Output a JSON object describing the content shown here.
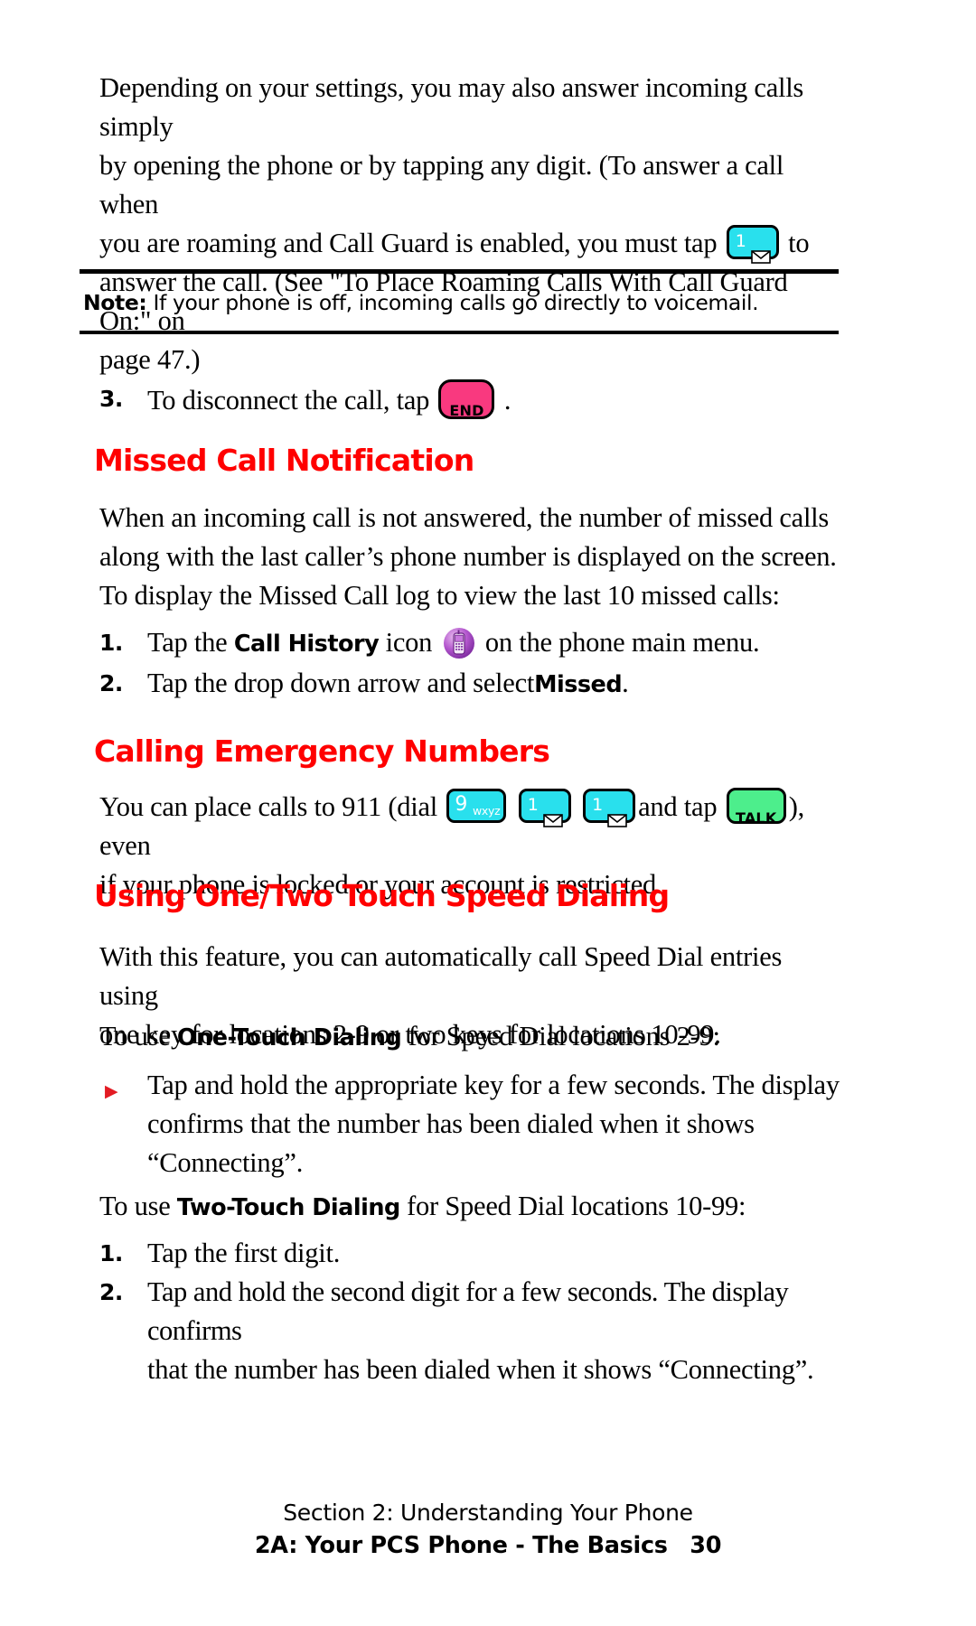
{
  "page": {
    "number": "30",
    "background": "#ffffff"
  },
  "colors": {
    "heading_red": "#FF0000",
    "key_cyan": "#29E0ED",
    "key_end_pink": "#F9397F",
    "key_talk_green": "#4DEE8C",
    "icon_purple": "#9B3FBF",
    "bullet_red": "#E31B23",
    "text_black": "#000000"
  },
  "intro": {
    "paragraph_line1": "Depending on your settings, you may also answer incoming calls simply",
    "paragraph_line2": "by opening the phone or by tapping any digit. (To answer a call when",
    "paragraph_line3_before_key": "you are roaming and Call Guard is enabled, you must tap",
    "paragraph_line3_after_key": "to",
    "paragraph_line4": "answer the call. (See \"To Place Roaming Calls With Call Guard On:\" on",
    "paragraph_line5": "page 47.)"
  },
  "note": {
    "label": "Note:",
    "text": "If your phone is off, incoming calls go directly to voicemail."
  },
  "step3": {
    "marker": "3.",
    "text_before_key": "To disconnect the call, tap",
    "text_after_key": "."
  },
  "missed_call": {
    "heading": "Missed Call Notification",
    "para1_line1": "When an incoming call is not answered, the number of missed calls",
    "para1_line2": "along with the last caller’s phone number is displayed on the screen.",
    "para2": "To display the Missed Call log to view the last 10 missed calls:",
    "steps": [
      {
        "marker": "1.",
        "before_bold": "Tap the",
        "bold": "Call History",
        "after_bold": "icon",
        "after_icon": "on the phone main menu."
      },
      {
        "marker": "2.",
        "before_bold": "Tap the drop down arrow and select",
        "bold": "Missed",
        "after_bold": "."
      }
    ]
  },
  "emergency": {
    "heading": "Calling Emergency Numbers",
    "line1_seg1": "You can place calls to 911 (dial",
    "line1_seg2": "and tap",
    "line1_seg3": "), even",
    "line2": "if your phone is locked or your account is restricted."
  },
  "speed_dialing": {
    "heading": "Using One/Two Touch Speed Dialing",
    "para_line1": "With this feature, you can automatically call Speed Dial entries using",
    "para_line2": "one key for locations 2-9 or two keys for locations 10-99.",
    "one_touch_intro": {
      "before_bold": "To use",
      "bold": "One-Touch Dialing",
      "after_bold": "for Speed Dial locations 2-9:"
    },
    "one_touch_bullet": {
      "marker": "▶",
      "line1": "Tap and hold the appropriate key for a few seconds. The display",
      "line2": "confirms that the number has been dialed when it shows",
      "line3": "“Connecting”."
    },
    "two_touch_intro": {
      "before_bold": "To use",
      "bold": "Two-Touch Dialing",
      "after_bold": "for Speed Dial locations 10-99:"
    },
    "two_touch_steps": [
      {
        "marker": "1.",
        "line1": "Tap the first digit.",
        "line2": ""
      },
      {
        "marker": "2.",
        "line1": "Tap and hold the second digit for a few seconds. The display confirms",
        "line2": "that the number has been dialed when it shows “Connecting”."
      }
    ]
  },
  "keys": {
    "voicemail": {
      "name": "voicemail-key",
      "digit": "1",
      "icon": "envelope-icon"
    },
    "nine": {
      "name": "nine-key",
      "digit": "9",
      "letters": "wxyz"
    },
    "end": {
      "name": "end-key",
      "label": "END"
    },
    "talk": {
      "name": "talk-key",
      "label": "TALK"
    },
    "call_history_icon": {
      "name": "call-history-icon"
    }
  },
  "footer": {
    "line1": "Section 2: Understanding Your Phone",
    "line2": "2A: Your PCS Phone - The Basics",
    "page_number": "30"
  }
}
